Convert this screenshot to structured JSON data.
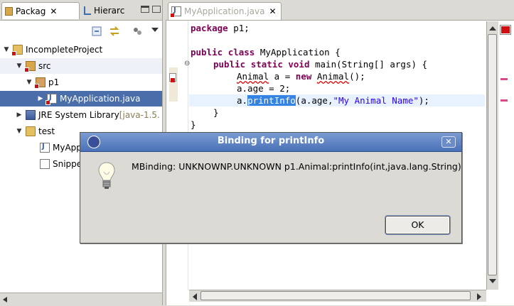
{
  "left_tabs": [
    {
      "label": "Packag",
      "close": "✕"
    },
    {
      "label": "Hierarc"
    }
  ],
  "tree": [
    {
      "label": "IncompleteProject",
      "suffix": ""
    },
    {
      "label": "src",
      "suffix": ""
    },
    {
      "label": "p1",
      "suffix": ""
    },
    {
      "label": "MyApplication.java",
      "suffix": ""
    },
    {
      "label": "JRE System Library ",
      "suffix": "[java-1.5."
    },
    {
      "label": "test",
      "suffix": ""
    },
    {
      "label": "MyApp",
      "suffix": ""
    },
    {
      "label": "Snippe",
      "suffix": ""
    }
  ],
  "editor": {
    "tab_label": "MyApplication.java",
    "tab_close": "✕",
    "code": {
      "l1_kw": "package",
      "l1_rest": " p1;",
      "l2_kw1": "public",
      "l2_kw2": "class",
      "l2_rest": " MyApplication {",
      "l3_kw1": "public",
      "l3_kw2": "static",
      "l3_kw3": "void",
      "l3_rest": " main(String[] args) {",
      "l4_type": "Animal",
      "l4_mid": " a = ",
      "l4_kw": "new",
      "l4_sp": " ",
      "l4_type2": "Animal",
      "l4_end": "();",
      "l5": "a.age = 2;",
      "l6_pre": "a.",
      "l6_sel": "printInfo",
      "l6_mid": "(a.age,",
      "l6_str": "\"My Animal Name\"",
      "l6_end": ");",
      "l7": "}",
      "l8": "}"
    }
  },
  "dialog": {
    "title": "Binding for printInfo",
    "message": "MBinding: UNKNOWNP.UNKNOWN p1.Animal:printInfo(int,java.lang.String)",
    "ok_label": "OK",
    "close_glyph": "✕"
  },
  "colors": {
    "keyword": "#7f0055",
    "string": "#2a00ff",
    "selection": "#4a6ea9",
    "title_bar": "#4a71b8"
  }
}
